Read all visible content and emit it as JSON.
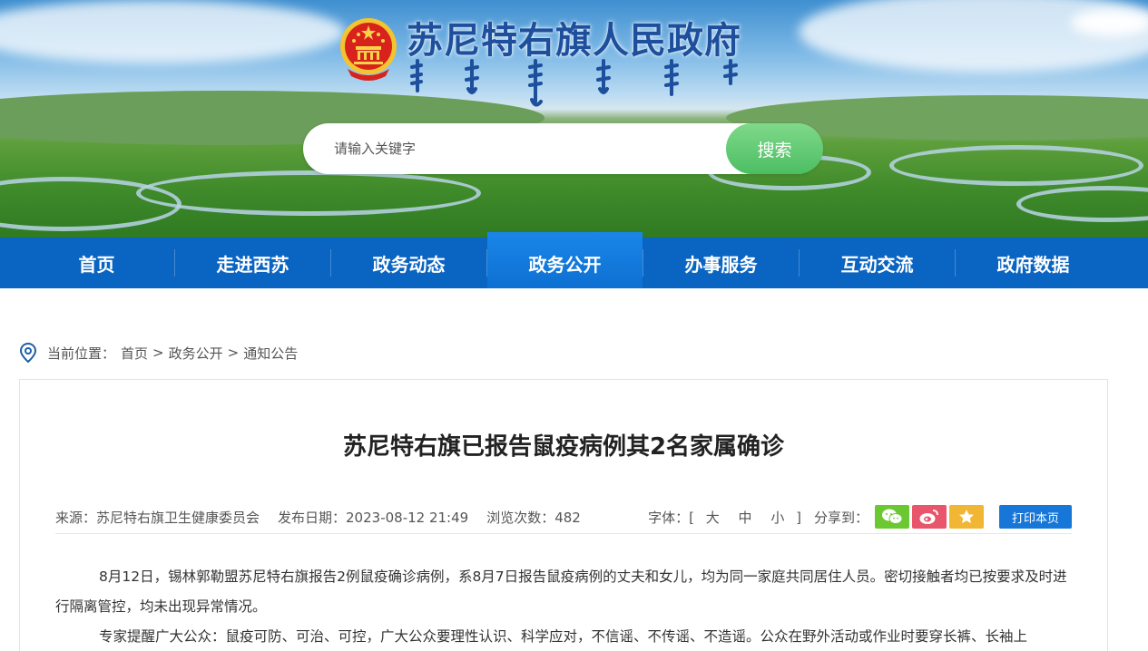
{
  "site": {
    "title": "苏尼特右旗人民政府",
    "search_placeholder": "请输入关键字",
    "search_button": "搜索"
  },
  "nav": {
    "items": [
      {
        "label": "首页"
      },
      {
        "label": "走进西苏"
      },
      {
        "label": "政务动态"
      },
      {
        "label": "政务公开",
        "active": true
      },
      {
        "label": "办事服务"
      },
      {
        "label": "互动交流"
      },
      {
        "label": "政府数据"
      }
    ]
  },
  "breadcrumb": {
    "prefix": "当前位置：",
    "items": [
      "首页",
      "政务公开",
      "通知公告"
    ]
  },
  "article": {
    "title": "苏尼特右旗已报告鼠疫病例其2名家属确诊",
    "source": "来源：苏尼特右旗卫生健康委员会",
    "date": "发布日期：2023-08-12 21:49",
    "views": "浏览次数：482",
    "font_label": "字体：[",
    "font_large": "大",
    "font_medium": "中",
    "font_small": "小",
    "font_close": "]",
    "share_label": "分享到：",
    "print_label": "打印本页",
    "paragraphs": [
      "8月12日，锡林郭勒盟苏尼特右旗报告2例鼠疫确诊病例，系8月7日报告鼠疫病例的丈夫和女儿，均为同一家庭共同居住人员。密切接触者均已按要求及时进行隔离管控，均未出现异常情况。",
      "专家提醒广大公众：鼠疫可防、可治、可控，广大公众要理性认识、科学应对，不信谣、不传谣、不造谣。公众在野外活动或作业时要穿长裤、长袖上"
    ]
  },
  "colors": {
    "nav_bg": "#0a64c2",
    "nav_active": "#1a86e8",
    "title_blue": "#1d4f9c",
    "search_green": "#4cbe62",
    "wechat_green": "#6cc832",
    "weibo_red": "#e9566b",
    "fav_yellow": "#f0b634",
    "print_blue": "#1777d8"
  },
  "icons": {
    "emblem": "national-emblem-icon",
    "location": "location-pin-icon",
    "wechat": "wechat-icon",
    "weibo": "weibo-icon",
    "favorite": "star-icon"
  }
}
